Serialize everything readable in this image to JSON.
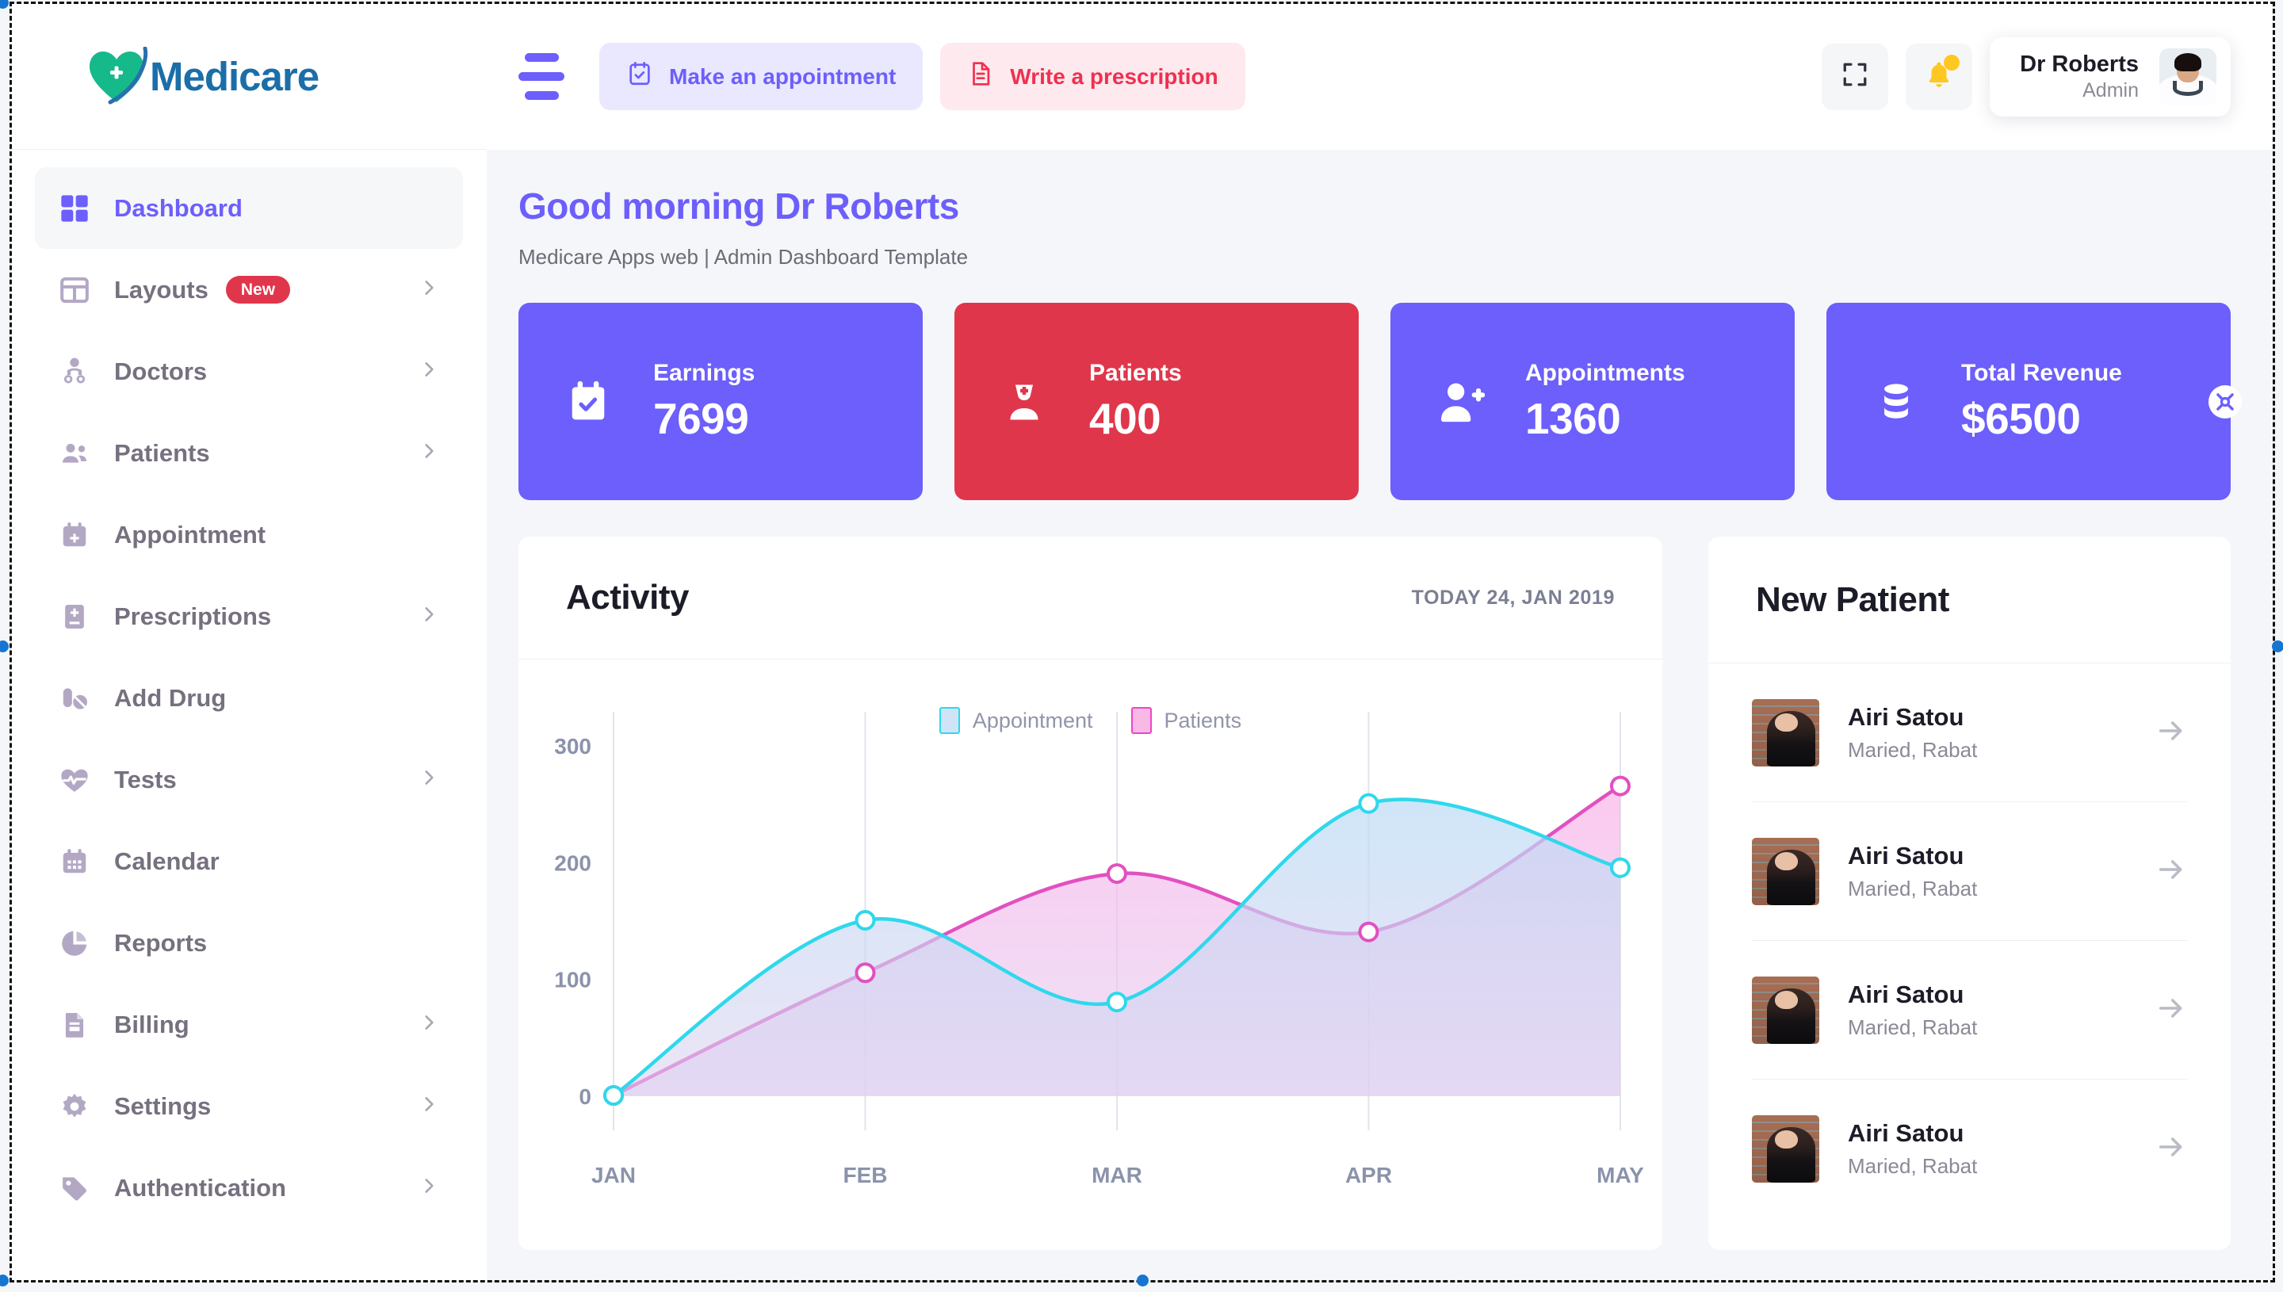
{
  "brand": {
    "name": "Medicare"
  },
  "sidebar": {
    "items": [
      {
        "label": "Dashboard",
        "icon": "grid-icon",
        "active": true,
        "chevron": false,
        "badge": null
      },
      {
        "label": "Layouts",
        "icon": "table-icon",
        "active": false,
        "chevron": true,
        "badge": "New"
      },
      {
        "label": "Doctors",
        "icon": "doctor-icon",
        "active": false,
        "chevron": true,
        "badge": null
      },
      {
        "label": "Patients",
        "icon": "people-icon",
        "active": false,
        "chevron": true,
        "badge": null
      },
      {
        "label": "Appointment",
        "icon": "calendar-plus-icon",
        "active": false,
        "chevron": false,
        "badge": null
      },
      {
        "label": "Prescriptions",
        "icon": "prescription-book-icon",
        "active": false,
        "chevron": true,
        "badge": null
      },
      {
        "label": "Add Drug",
        "icon": "pills-icon",
        "active": false,
        "chevron": false,
        "badge": null
      },
      {
        "label": "Tests",
        "icon": "heart-pulse-icon",
        "active": false,
        "chevron": true,
        "badge": null
      },
      {
        "label": "Calendar",
        "icon": "calendar-icon",
        "active": false,
        "chevron": false,
        "badge": null
      },
      {
        "label": "Reports",
        "icon": "pie-chart-icon",
        "active": false,
        "chevron": false,
        "badge": null
      },
      {
        "label": "Billing",
        "icon": "invoice-icon",
        "active": false,
        "chevron": true,
        "badge": null
      },
      {
        "label": "Settings",
        "icon": "gear-icon",
        "active": false,
        "chevron": true,
        "badge": null
      },
      {
        "label": "Authentication",
        "icon": "tag-icon",
        "active": false,
        "chevron": true,
        "badge": null
      }
    ]
  },
  "topbar": {
    "menu_icon": "hamburger-icon",
    "appointment_button": "Make an appointment",
    "prescription_button": "Write a prescription",
    "fullscreen_icon": "fullscreen-icon",
    "notification_icon": "bell-icon",
    "user_name": "Dr Roberts",
    "user_role": "Admin",
    "avatar_icon": "doctor-avatar"
  },
  "page": {
    "greeting": "Good morning Dr Roberts",
    "subtitle": "Medicare Apps web | Admin Dashboard Template"
  },
  "stats": [
    {
      "title": "Earnings",
      "value": "7699",
      "color": "#6c5ffc",
      "icon": "calendar-check-icon",
      "close": false
    },
    {
      "title": "Patients",
      "value": "400",
      "color": "#e0364b",
      "icon": "nurse-icon",
      "close": false
    },
    {
      "title": "Appointments",
      "value": "1360",
      "color": "#6c5ffc",
      "icon": "user-plus-icon",
      "close": false
    },
    {
      "title": "Total Revenue",
      "value": "$6500",
      "color": "#6c5ffc",
      "icon": "database-icon",
      "close": true
    }
  ],
  "activity": {
    "title": "Activity",
    "date": "TODAY 24, JAN 2019"
  },
  "chart_data": {
    "type": "area",
    "title": "Activity",
    "categories": [
      "JAN",
      "FEB",
      "MAR",
      "APR",
      "MAY"
    ],
    "series": [
      {
        "name": "Appointment",
        "values": [
          0,
          150,
          80,
          250,
          195
        ],
        "color": "#2fd8ec",
        "fill": "#cfe5f7"
      },
      {
        "name": "Patients",
        "values": [
          0,
          105,
          190,
          140,
          265
        ],
        "color": "#e250c0",
        "fill": "#f9b9e6"
      }
    ],
    "xlabel": "",
    "ylabel": "",
    "ylim": [
      0,
      300
    ],
    "yticks": [
      0,
      100,
      200,
      300
    ],
    "grid": true,
    "legend_position": "top-center"
  },
  "new_patient": {
    "title": "New Patient",
    "rows": [
      {
        "name": "Airi Satou",
        "detail": "Maried, Rabat",
        "arrow": "arrow-right-icon"
      },
      {
        "name": "Airi Satou",
        "detail": "Maried, Rabat",
        "arrow": "arrow-right-icon"
      },
      {
        "name": "Airi Satou",
        "detail": "Maried, Rabat",
        "arrow": "arrow-right-icon"
      },
      {
        "name": "Airi Satou",
        "detail": "Maried, Rabat",
        "arrow": "arrow-right-icon"
      }
    ]
  }
}
